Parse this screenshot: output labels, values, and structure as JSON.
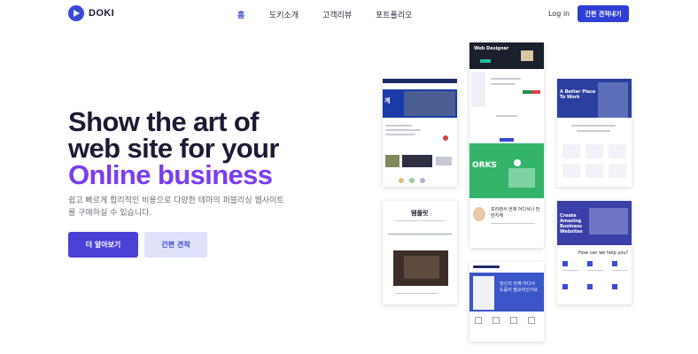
{
  "brand": {
    "name": "DOKI",
    "accent": "#3a4bd8",
    "title_accent": "#7a3df0"
  },
  "nav": {
    "items": [
      {
        "label": "홈",
        "active": true
      },
      {
        "label": "도키소개",
        "active": false
      },
      {
        "label": "고객리뷰",
        "active": false
      },
      {
        "label": "포트폴리오",
        "active": false
      }
    ],
    "login_label": "Log in",
    "quote_label": "간편 견적내기"
  },
  "hero": {
    "title_line1": "Show the art of",
    "title_line2": "web site for your",
    "title_line3": "Online business",
    "subtitle": "쉽고 빠르게 합리적인 비용으로 다양한 테마의 퍼블리싱 웹사이트를 구매하실 수 있습니다.",
    "primary_button": "더 알아보기",
    "secondary_button": "간편 견적"
  },
  "showcase": {
    "col1_title_text": "계",
    "col1_heading": "템플릿",
    "col2_top_heading": "Web Designer",
    "col2_works": "ORKS",
    "col2_band_text": "프리랜서 언제 어디서나 만반지계",
    "col2_bottom_text": "당신의 언제 어디서 도움이 필요하신가요",
    "col3_top_heading": "A Better Place To Work",
    "col3_bottom_heading": "Create Amazing Business Websites",
    "col3_help_heading": "How can we help you?"
  }
}
